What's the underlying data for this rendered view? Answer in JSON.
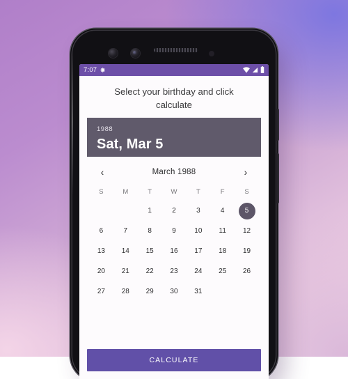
{
  "status_bar": {
    "clock": "7:07",
    "settings_icon": "gear-icon",
    "wifi_icon": "wifi-icon",
    "signal_icon": "cell-signal-icon",
    "battery_icon": "battery-icon",
    "background_color": "#6d4fa8"
  },
  "app": {
    "title": "Select your birthday and click calculate",
    "background_color": "#fdfbfd",
    "accent_color": "#6150a8"
  },
  "date_header": {
    "year": "1988",
    "full_date": "Sat, Mar 5",
    "background_color": "#605a6b"
  },
  "month_nav": {
    "prev_label": "‹",
    "next_label": "›",
    "month_label": "March 1988"
  },
  "calendar": {
    "weekdays": [
      "S",
      "M",
      "T",
      "W",
      "T",
      "F",
      "S"
    ],
    "selected_day": 5,
    "selected_color": "#5d5668",
    "weeks": [
      [
        "",
        "",
        1,
        2,
        3,
        4,
        5
      ],
      [
        6,
        7,
        8,
        9,
        10,
        11,
        12
      ],
      [
        13,
        14,
        15,
        16,
        17,
        18,
        19
      ],
      [
        20,
        21,
        22,
        23,
        24,
        25,
        26
      ],
      [
        27,
        28,
        29,
        30,
        31,
        "",
        ""
      ]
    ]
  },
  "calculate_button": {
    "label": "CALCULATE",
    "background_color": "#6150a8"
  }
}
